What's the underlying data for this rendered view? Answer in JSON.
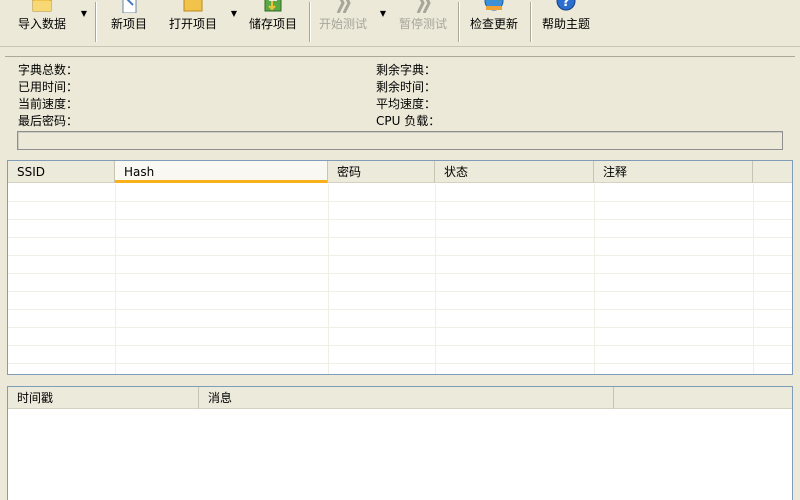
{
  "toolbar": {
    "buttons": [
      {
        "label": "导入数据",
        "icon": "folder-import-icon",
        "disabled": false
      },
      {
        "label": "新项目",
        "icon": "new-document-icon",
        "disabled": false
      },
      {
        "label": "打开项目",
        "icon": "folder-open-icon",
        "disabled": false
      },
      {
        "label": "储存项目",
        "icon": "save-project-icon",
        "disabled": false
      },
      {
        "label": "开始测试",
        "icon": "start-test-icon",
        "disabled": true
      },
      {
        "label": "暂停测试",
        "icon": "pause-test-icon",
        "disabled": true
      },
      {
        "label": "检查更新",
        "icon": "globe-update-icon",
        "disabled": false
      },
      {
        "label": "帮助主题",
        "icon": "help-icon",
        "disabled": false
      }
    ]
  },
  "stats": {
    "dict_total": "字典总数：",
    "elapsed_time": "已用时间：",
    "current_speed": "当前速度：",
    "last_password": "最后密码：",
    "dict_remaining": "剩余字典：",
    "time_remaining": "剩余时间：",
    "average_speed": "平均速度：",
    "cpu_load": "CPU 负载："
  },
  "results_table": {
    "columns": [
      "SSID",
      "Hash",
      "密码",
      "状态",
      "注释"
    ],
    "sorted_column": "Hash"
  },
  "log_table": {
    "columns": [
      "时间戳",
      "消息"
    ]
  },
  "colors": {
    "window_bg": "#ece9d8",
    "sort_indicator": "#f9b11b",
    "grid_border": "#7f9db9"
  }
}
